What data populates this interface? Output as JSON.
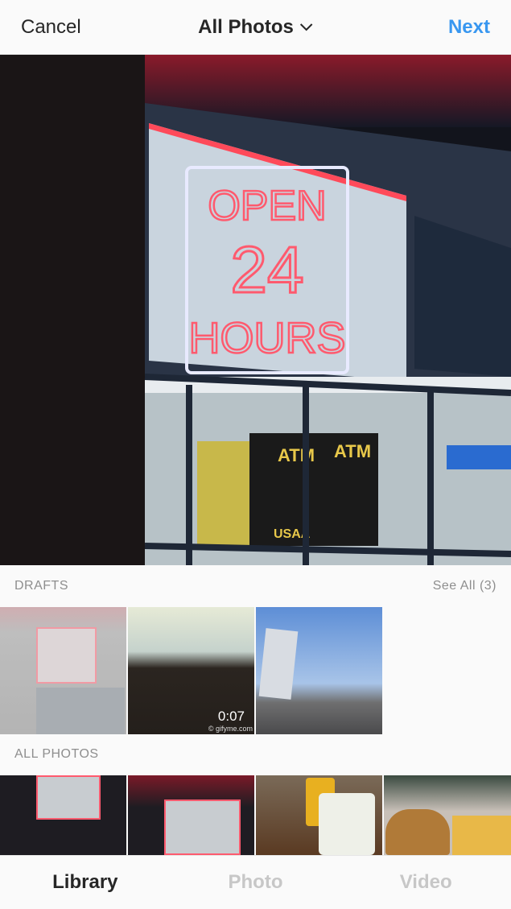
{
  "header": {
    "cancel": "Cancel",
    "title": "All Photos",
    "next": "Next"
  },
  "preview": {
    "sign": [
      "OPEN",
      "24",
      "HOURS"
    ],
    "atm": "ATM",
    "usaa": "USAA"
  },
  "drafts": {
    "label": "DRAFTS",
    "see_all": "See All (3)",
    "video_duration": "0:07",
    "watermark": "© gifyme.com"
  },
  "all_photos": {
    "label": "ALL PHOTOS"
  },
  "tabs": [
    {
      "label": "Library",
      "active": true
    },
    {
      "label": "Photo"
    },
    {
      "label": "Video"
    }
  ],
  "colors": {
    "accent": "#3897f0",
    "neon": "#ff5a6e"
  }
}
